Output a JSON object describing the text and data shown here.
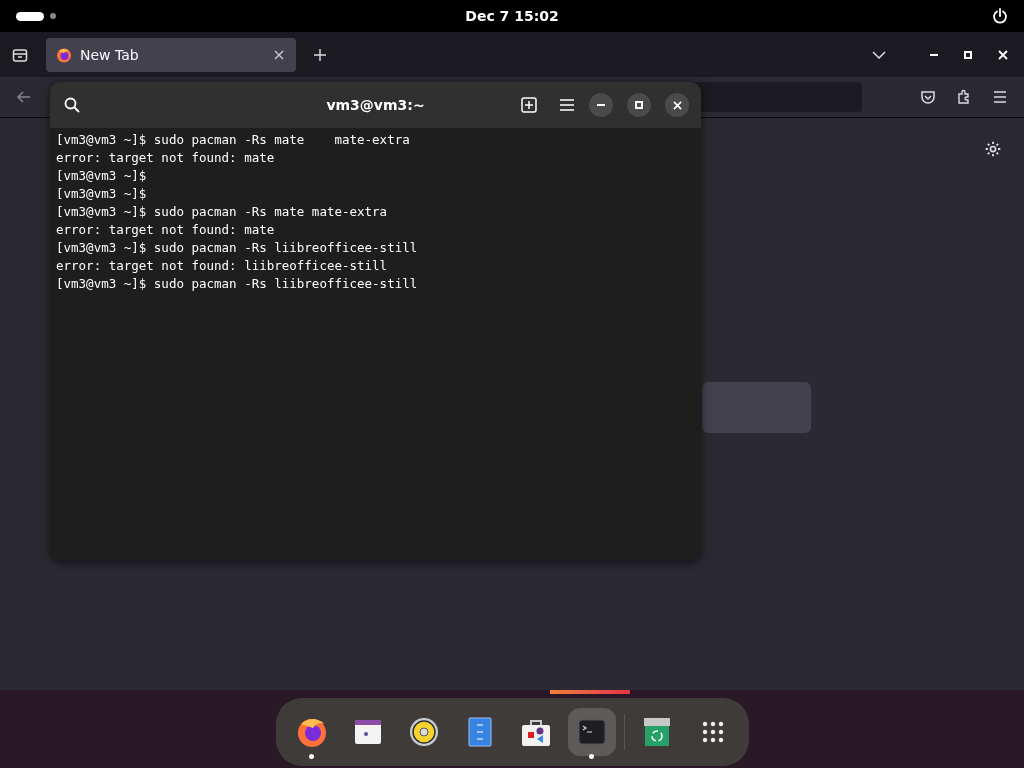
{
  "top_bar": {
    "clock": "Dec 7  15:02"
  },
  "browser": {
    "tabs": [
      {
        "label": "New Tab",
        "selected": true
      }
    ]
  },
  "terminal": {
    "title": "vm3@vm3:~",
    "lines": [
      "[vm3@vm3 ~]$ sudo pacman -Rs mate    mate-extra",
      "error: target not found: mate",
      "[vm3@vm3 ~]$",
      "[vm3@vm3 ~]$",
      "[vm3@vm3 ~]$ sudo pacman -Rs mate mate-extra",
      "error: target not found: mate",
      "[vm3@vm3 ~]$ sudo pacman -Rs liibreofficee-still",
      "error: target not found: liibreofficee-still",
      "[vm3@vm3 ~]$ sudo pacman -Rs liibreofficee-still"
    ]
  },
  "dock": {
    "items": [
      {
        "kind": "browser",
        "running": true,
        "selected": false
      },
      {
        "kind": "calendar",
        "running": false,
        "selected": false
      },
      {
        "kind": "speaker",
        "running": false,
        "selected": false
      },
      {
        "kind": "cabinet",
        "running": false,
        "selected": false
      },
      {
        "kind": "store",
        "running": false,
        "selected": false
      },
      {
        "kind": "terminal",
        "running": true,
        "selected": true
      },
      {
        "kind": "trash",
        "running": false,
        "selected": false
      },
      {
        "kind": "apps",
        "running": false,
        "selected": false
      }
    ]
  }
}
